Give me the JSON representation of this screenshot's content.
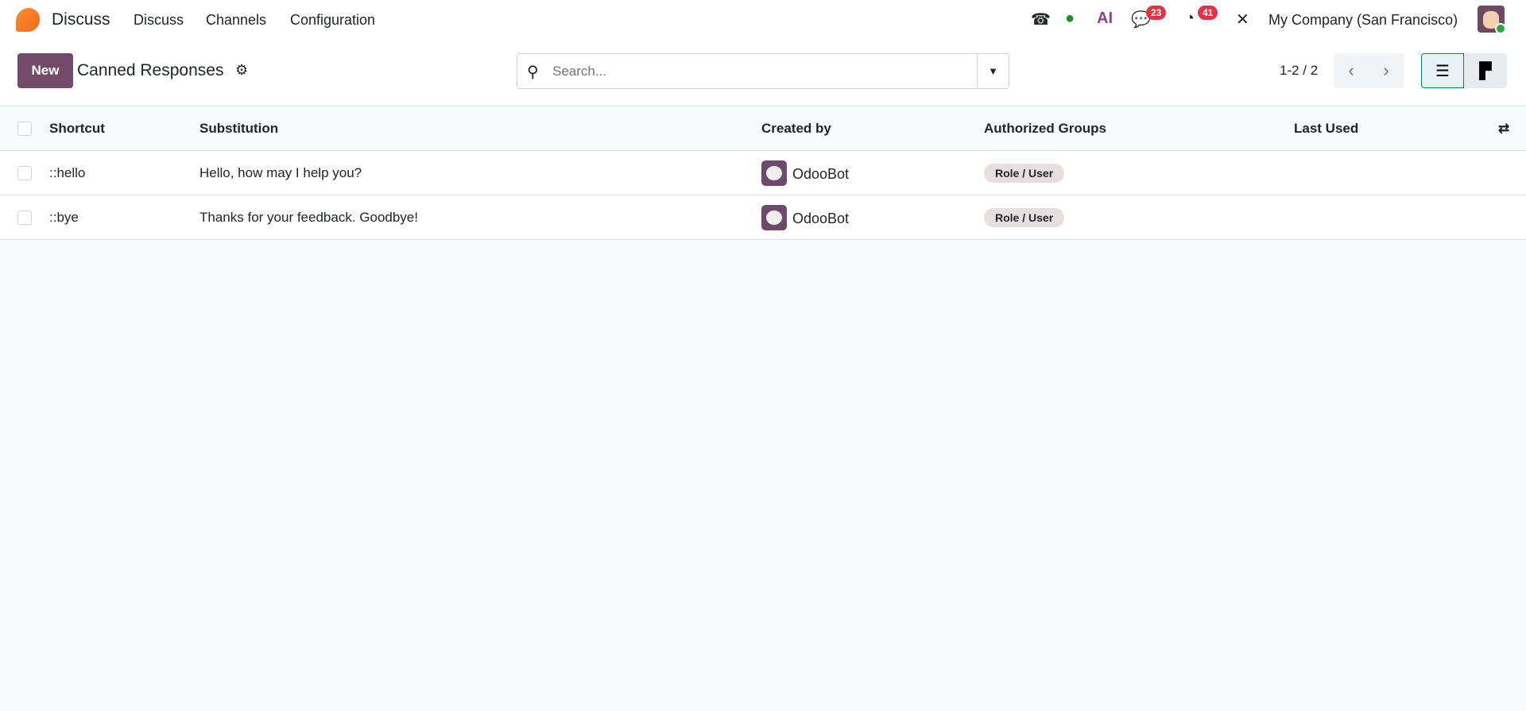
{
  "nav": {
    "app": "Discuss",
    "menu": [
      "Discuss",
      "Channels",
      "Configuration"
    ],
    "chat_badge": "23",
    "activity_badge": "41",
    "ai": "AI",
    "company": "My Company (San Francisco)"
  },
  "cp": {
    "new": "New",
    "title": "Canned Responses",
    "search_placeholder": "Search...",
    "pager": "1-2 / 2"
  },
  "table": {
    "headers": [
      "Shortcut",
      "Substitution",
      "Created by",
      "Authorized Groups",
      "Last Used"
    ],
    "rows": [
      {
        "shortcut": "::hello",
        "substitution": "Hello, how may I help you?",
        "created_by": "OdooBot",
        "group": "Role / User",
        "last_used": ""
      },
      {
        "shortcut": "::bye",
        "substitution": "Thanks for your feedback. Goodbye!",
        "created_by": "OdooBot",
        "group": "Role / User",
        "last_used": ""
      }
    ]
  }
}
